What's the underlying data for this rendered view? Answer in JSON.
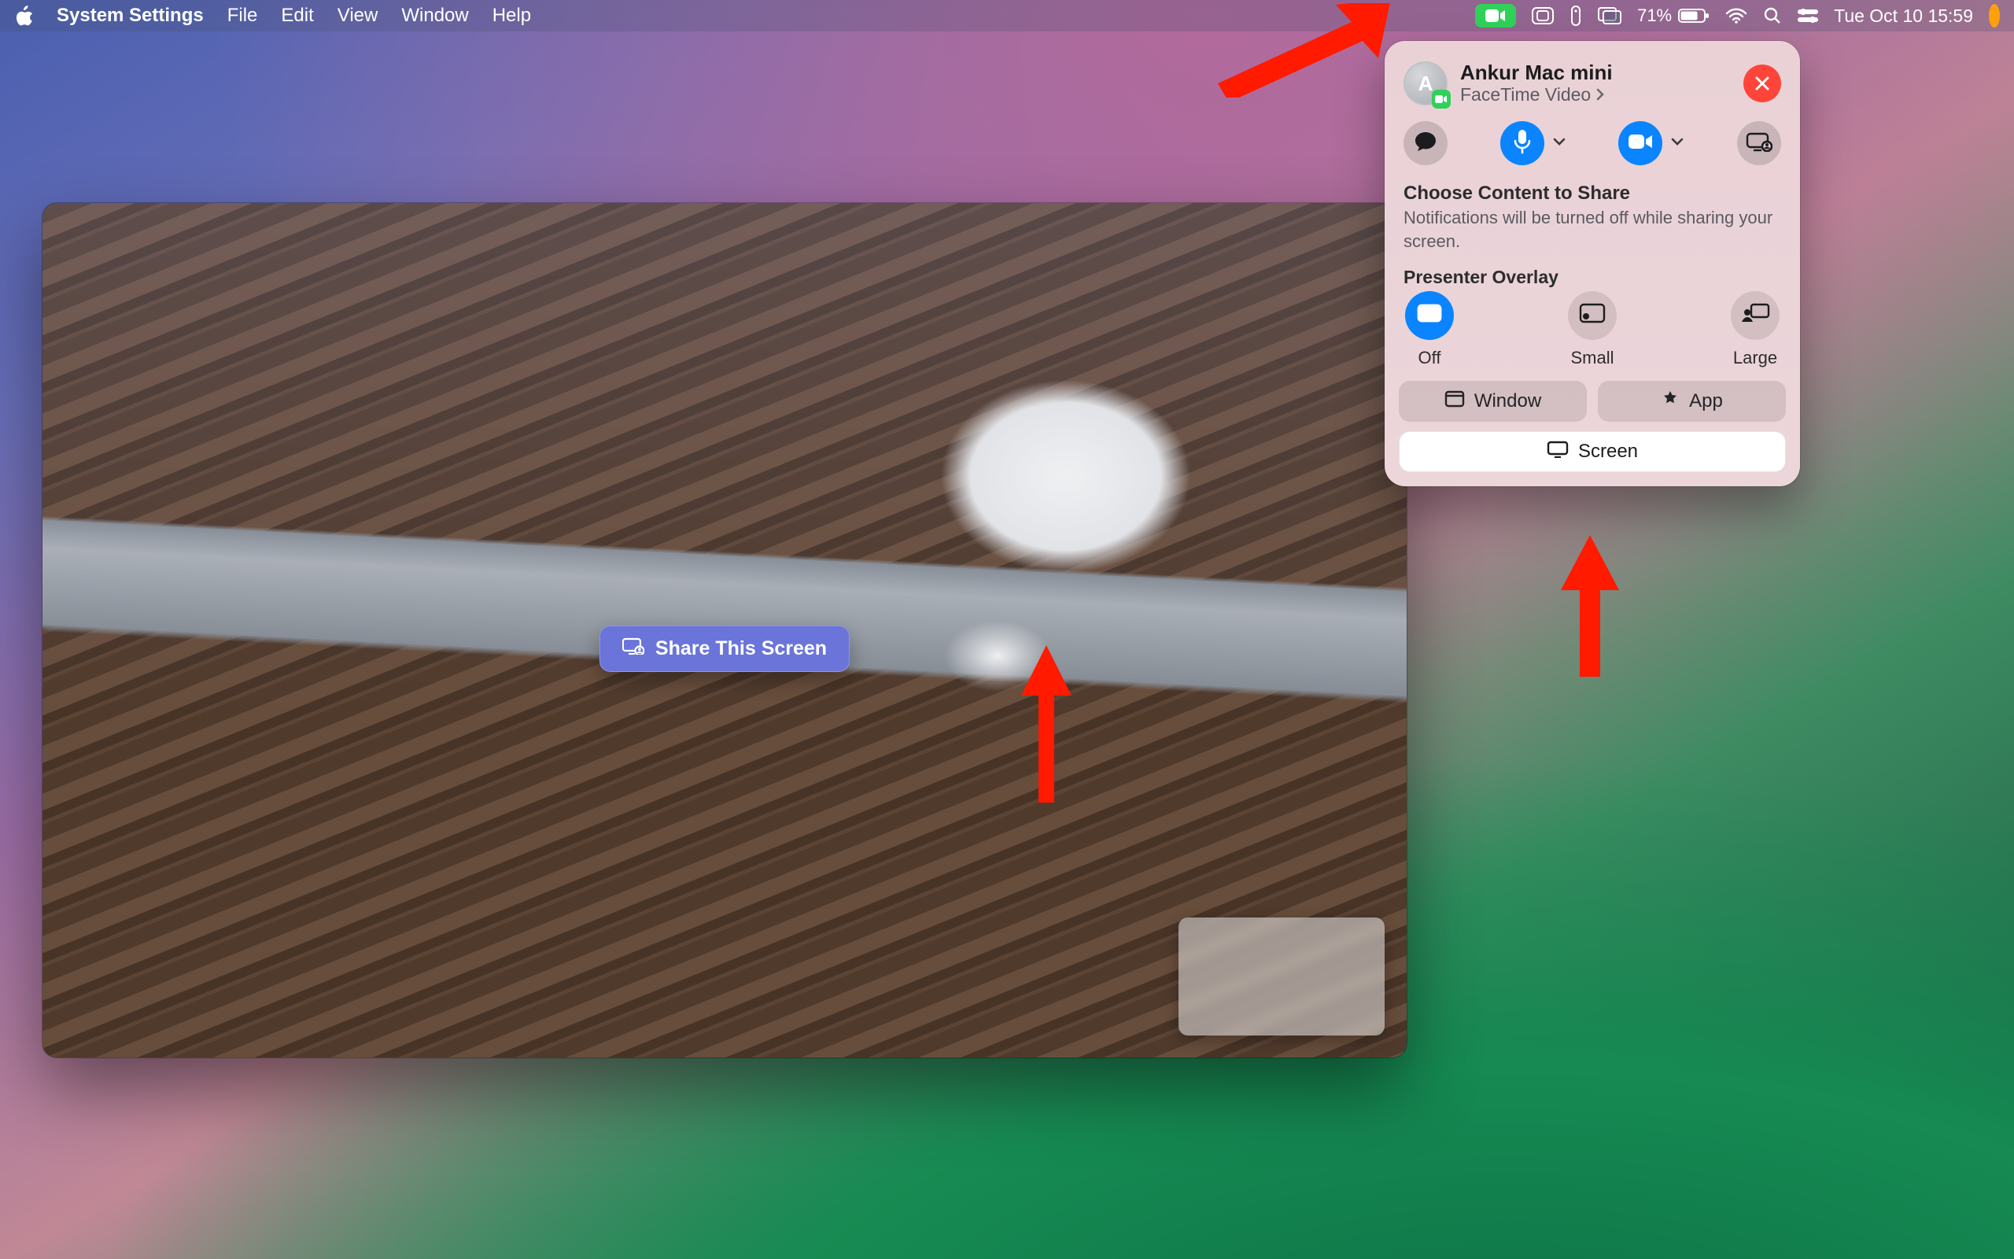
{
  "menubar": {
    "app": "System Settings",
    "items": [
      "File",
      "Edit",
      "View",
      "Window",
      "Help"
    ],
    "battery_percent": "71%",
    "clock": "Tue Oct 10  15:59"
  },
  "facetime_window": {
    "share_button_label": "Share This Screen"
  },
  "ft_panel": {
    "caller_name": "Ankur Mac mini",
    "caller_sub": "FaceTime Video",
    "choose_title": "Choose Content to Share",
    "choose_sub": "Notifications will be turned off while sharing your screen.",
    "overlay_title": "Presenter Overlay",
    "overlay_options": {
      "off": "Off",
      "small": "Small",
      "large": "Large"
    },
    "window_label": "Window",
    "app_label": "App",
    "screen_label": "Screen"
  },
  "colors": {
    "accent_blue": "#0a84ff",
    "accent_red": "#ff453a",
    "facetime_green": "#30d158"
  }
}
